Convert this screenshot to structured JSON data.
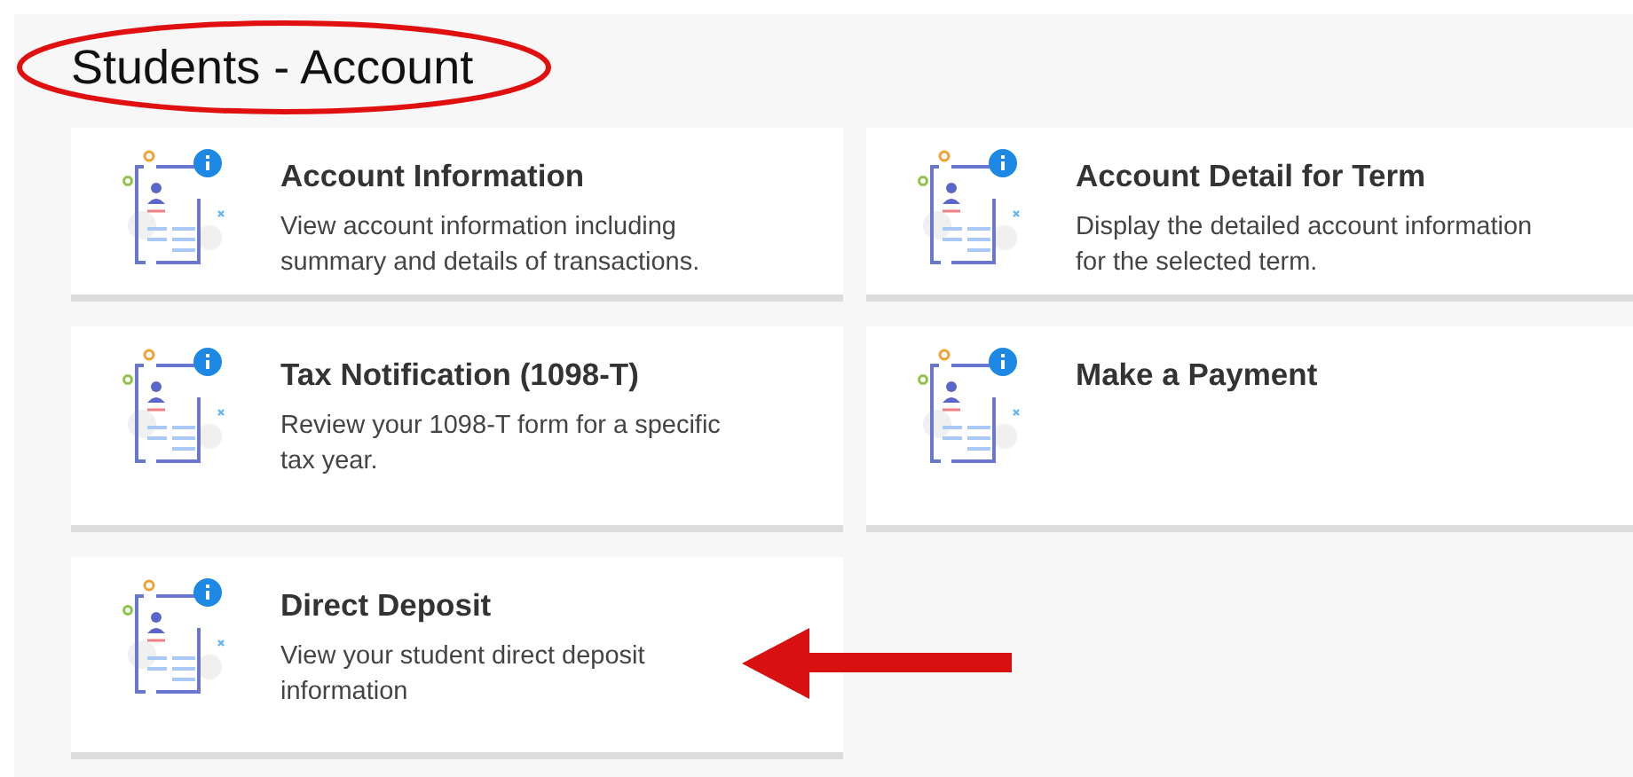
{
  "page": {
    "title": "Students - Account"
  },
  "cards": [
    {
      "title": "Account Information",
      "description": "View account information including summary and details of transactions."
    },
    {
      "title": "Account Detail for Term",
      "description": "Display the detailed account information for the selected term."
    },
    {
      "title": "Tax Notification (1098-T)",
      "description": "Review your 1098-T form for a specific tax year."
    },
    {
      "title": "Make a Payment"
    },
    {
      "title": "Direct Deposit",
      "description": "View your student direct deposit information"
    }
  ]
}
